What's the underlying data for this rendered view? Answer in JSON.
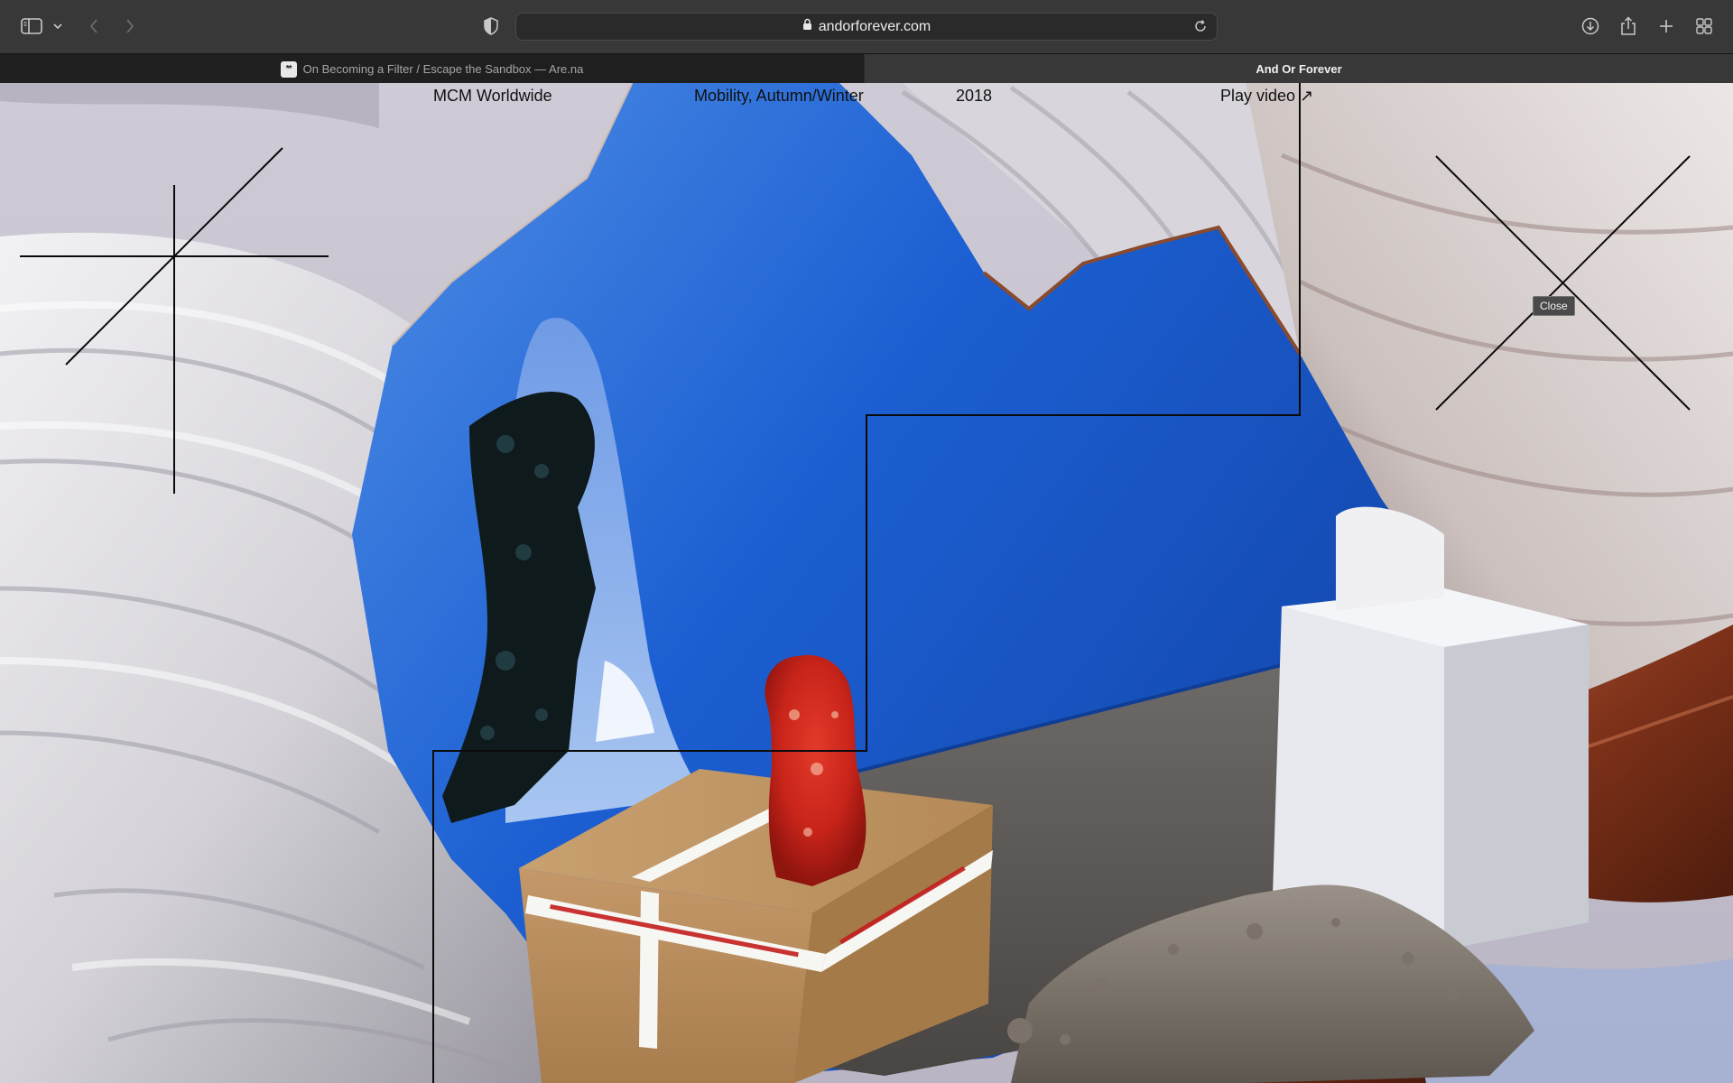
{
  "browser": {
    "url": "andorforever.com",
    "tabs": [
      {
        "label": "On Becoming a Filter / Escape the Sandbox — Are.na",
        "favicon": "**",
        "active": false
      },
      {
        "label": "And Or Forever",
        "active": true
      }
    ],
    "icons": [
      "sidebar-icon",
      "chevron-down-icon",
      "back-icon",
      "forward-icon",
      "shield-icon",
      "lock-icon",
      "reload-icon",
      "download-icon",
      "share-icon",
      "new-tab-icon",
      "tab-overview-icon"
    ]
  },
  "project": {
    "client": "MCM Worldwide",
    "title": "Mobility, Autumn/Winter",
    "year": "2018",
    "play_label": "Play video",
    "play_arrow": "↗"
  },
  "close": {
    "tooltip": "Close"
  },
  "colors": {
    "chrome": "#383838",
    "tabbar": "#1f1f1f",
    "studio_blue": "#1d5fd0",
    "fabric_white": "#e6e4ea",
    "fabric_rust": "#8a3a22",
    "cardboard": "#c69a63"
  }
}
